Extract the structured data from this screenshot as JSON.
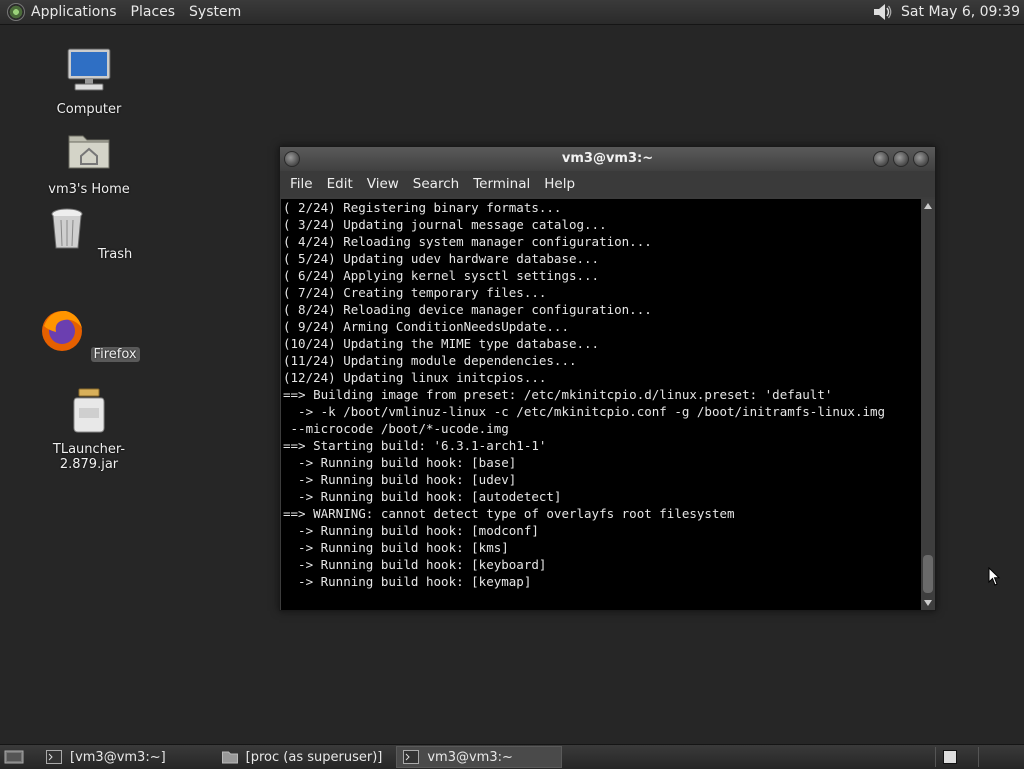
{
  "top_panel": {
    "menus": [
      "Applications",
      "Places",
      "System"
    ],
    "clock": "Sat May  6, 09:39"
  },
  "desktop": {
    "icons": [
      {
        "label": "Computer",
        "icon": "computer-icon"
      },
      {
        "label": "vm3's Home",
        "icon": "home-folder-icon"
      },
      {
        "label": "Trash",
        "icon": "trash-icon"
      },
      {
        "label": "Firefox",
        "icon": "firefox-icon"
      },
      {
        "label": "TLauncher-2.879.jar",
        "icon": "jar-icon"
      }
    ]
  },
  "window": {
    "title": "vm3@vm3:~",
    "menu": [
      "File",
      "Edit",
      "View",
      "Search",
      "Terminal",
      "Help"
    ],
    "terminal_lines": [
      "( 2/24) Registering binary formats...",
      "( 3/24) Updating journal message catalog...",
      "( 4/24) Reloading system manager configuration...",
      "( 5/24) Updating udev hardware database...",
      "( 6/24) Applying kernel sysctl settings...",
      "( 7/24) Creating temporary files...",
      "( 8/24) Reloading device manager configuration...",
      "( 9/24) Arming ConditionNeedsUpdate...",
      "(10/24) Updating the MIME type database...",
      "(11/24) Updating module dependencies...",
      "(12/24) Updating linux initcpios...",
      "==> Building image from preset: /etc/mkinitcpio.d/linux.preset: 'default'",
      "  -> -k /boot/vmlinuz-linux -c /etc/mkinitcpio.conf -g /boot/initramfs-linux.img",
      " --microcode /boot/*-ucode.img",
      "==> Starting build: '6.3.1-arch1-1'",
      "  -> Running build hook: [base]",
      "  -> Running build hook: [udev]",
      "  -> Running build hook: [autodetect]",
      "==> WARNING: cannot detect type of overlayfs root filesystem",
      "  -> Running build hook: [modconf]",
      "  -> Running build hook: [kms]",
      "  -> Running build hook: [keyboard]",
      "  -> Running build hook: [keymap]"
    ]
  },
  "taskbar": {
    "tasks": [
      {
        "label": "[vm3@vm3:~]",
        "icon": "terminal-icon"
      },
      {
        "label": "[proc (as superuser)]",
        "icon": "folder-icon"
      },
      {
        "label": "vm3@vm3:~",
        "icon": "terminal-icon"
      }
    ]
  }
}
